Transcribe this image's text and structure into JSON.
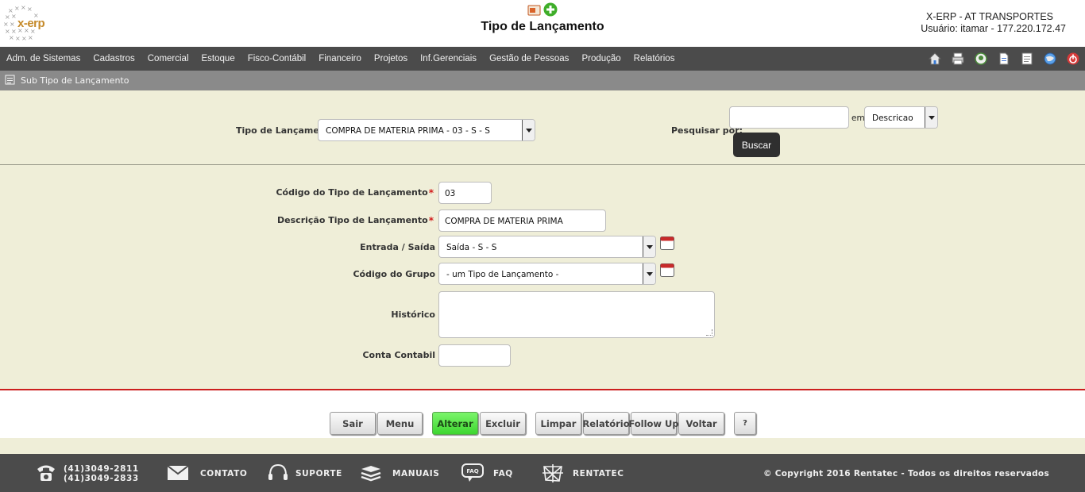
{
  "header": {
    "logo_text": "x-erp",
    "title": "Tipo de Lançamento",
    "company": "X-ERP - AT TRANSPORTES",
    "user": "Usuário: itamar - 177.220.172.47"
  },
  "nav": {
    "items": [
      {
        "label": "Adm. de Sistemas"
      },
      {
        "label": "Cadastros"
      },
      {
        "label": "Comercial"
      },
      {
        "label": "Estoque"
      },
      {
        "label": "Fisco-Contábil"
      },
      {
        "label": "Financeiro"
      },
      {
        "label": "Projetos"
      },
      {
        "label": "Inf.Gerenciais"
      },
      {
        "label": "Gestão de Pessoas"
      },
      {
        "label": "Produção"
      },
      {
        "label": "Relatórios"
      }
    ],
    "icons": [
      "home-icon",
      "printer-icon",
      "badge-icon",
      "document-icon",
      "note-icon",
      "globe-icon",
      "power-icon"
    ]
  },
  "subbar": {
    "label": "Sub Tipo de Lançamento"
  },
  "search": {
    "tipo_label": "Tipo de Lançamento",
    "tipo_value": "COMPRA DE MATERIA PRIMA - 03 - S - S",
    "pesquisar_label": "Pesquisar por:",
    "search_value": "",
    "em_label": "em",
    "field_value": "Descricao",
    "buscar_label": "Buscar"
  },
  "form": {
    "codigo_label": "Código do Tipo de Lançamento",
    "codigo_value": "03",
    "descricao_label": "Descrição Tipo de Lançamento",
    "descricao_value": "COMPRA DE MATERIA PRIMA",
    "entrada_label": "Entrada / Saída",
    "entrada_value": "Saída - S - S",
    "grupo_label": "Código do Grupo",
    "grupo_value": "- um Tipo de Lançamento -",
    "historico_label": "Histórico",
    "historico_value": "",
    "conta_label": "Conta Contabil",
    "conta_value": "",
    "required_mark": "*"
  },
  "buttons": {
    "sair": "Sair",
    "menu": "Menu",
    "alterar": "Alterar",
    "excluir": "Excluir",
    "limpar": "Limpar",
    "relatorio": "Relatório",
    "followup": "Follow Up",
    "voltar": "Voltar",
    "help": "?"
  },
  "footer": {
    "phone1": "(41)3049-2811",
    "phone2": "(41)3049-2833",
    "contato": "CONTATO",
    "suporte": "SUPORTE",
    "manuais": "MANUAIS",
    "faq": "FAQ",
    "faq_icon_text": "FAQ",
    "rentatec": "RENTATEC",
    "copyright": "© Copyright 2016 Rentatec - Todos os direitos reservados"
  },
  "colors": {
    "nav_bg": "#4b4b4b",
    "subbar_bg": "#8a8a8a",
    "content_bg": "#efeed8",
    "accent_red": "#cc1f1f",
    "alterar_green": "#4fe340"
  }
}
